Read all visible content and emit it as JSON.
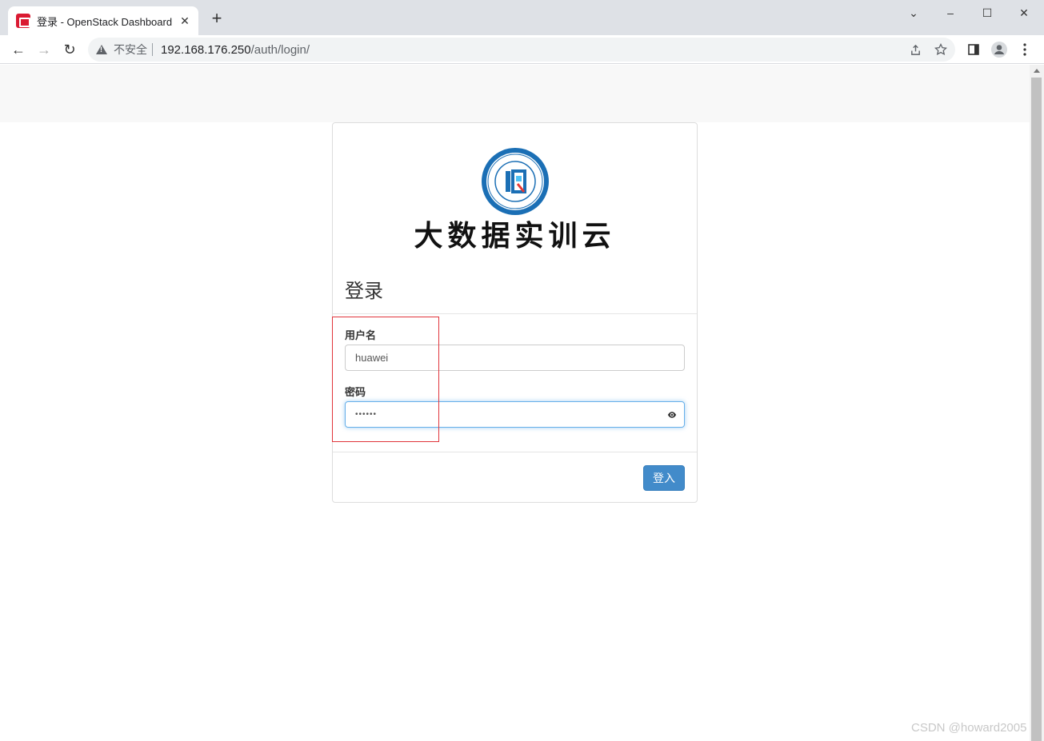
{
  "browser": {
    "tab_title": "登录 - OpenStack Dashboard",
    "tab_close": "✕",
    "new_tab": "+",
    "window_controls": {
      "minimize": "–",
      "maximize": "☐",
      "close": "✕",
      "tab_search": "⌄"
    },
    "nav": {
      "back": "←",
      "forward": "→",
      "reload": "↻"
    },
    "address": {
      "security_label": "不安全",
      "host": "192.168.176.250",
      "path": "/auth/login/"
    },
    "icons": [
      "share-icon",
      "star-icon",
      "side-panel-icon",
      "profile-icon",
      "menu-icon"
    ]
  },
  "login": {
    "brand_text": "大数据实训云",
    "title": "登录",
    "username_label": "用户名",
    "username_value": "huawei",
    "password_label": "密码",
    "password_value": "••••••",
    "submit_label": "登入"
  },
  "watermark": "CSDN @howard2005",
  "colors": {
    "primary": "#428bca",
    "favicon": "#da1a32",
    "highlight": "#e0353b",
    "seal": "#1b6fb5"
  }
}
